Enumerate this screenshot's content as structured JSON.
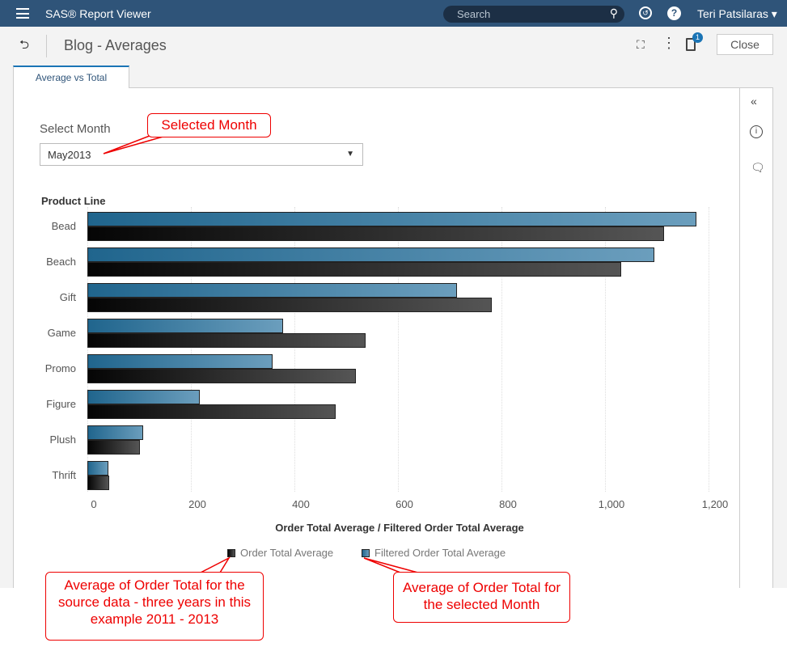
{
  "app": {
    "title": "SAS® Report Viewer",
    "search_placeholder": "Search",
    "user": "Teri Patsilaras ▾"
  },
  "report": {
    "title": "Blog - Averages",
    "close_label": "Close",
    "notes_badge": "1",
    "tab": "Average vs Total"
  },
  "filter": {
    "label": "Select Month",
    "value": "May2013"
  },
  "callouts": {
    "selected_month": "Selected Month",
    "order_total": "Average of Order Total for the source data - three years in this example 2011 - 2013",
    "selected_month_avg": "Average of Order Total for the selected Month"
  },
  "colors": {
    "header": "#2f5479",
    "accent": "#1a74b5",
    "filtered": "#2a6a8e",
    "total": "#222222",
    "callout": "#ee0000"
  },
  "chart_data": {
    "type": "bar",
    "orientation": "horizontal",
    "ylabel": "Product Line",
    "xlabel": "Order Total Average / Filtered Order Total Average",
    "categories": [
      "Bead",
      "Beach",
      "Gift",
      "Game",
      "Promo",
      "Figure",
      "Plush",
      "Thrift"
    ],
    "xlim": [
      0,
      1260
    ],
    "xticks": [
      0,
      200,
      400,
      600,
      800,
      1000,
      1200
    ],
    "xtick_labels": [
      "0",
      "200",
      "400",
      "600",
      "800",
      "1,000",
      "1,200"
    ],
    "series": [
      {
        "name": "Filtered Order Total Average",
        "values": [
          1177,
          1095,
          714,
          378,
          358,
          217,
          108,
          41
        ]
      },
      {
        "name": "Order Total Average",
        "values": [
          1114,
          1031,
          781,
          537,
          519,
          480,
          102,
          42
        ]
      }
    ],
    "legend": "bottom",
    "grid": true
  }
}
